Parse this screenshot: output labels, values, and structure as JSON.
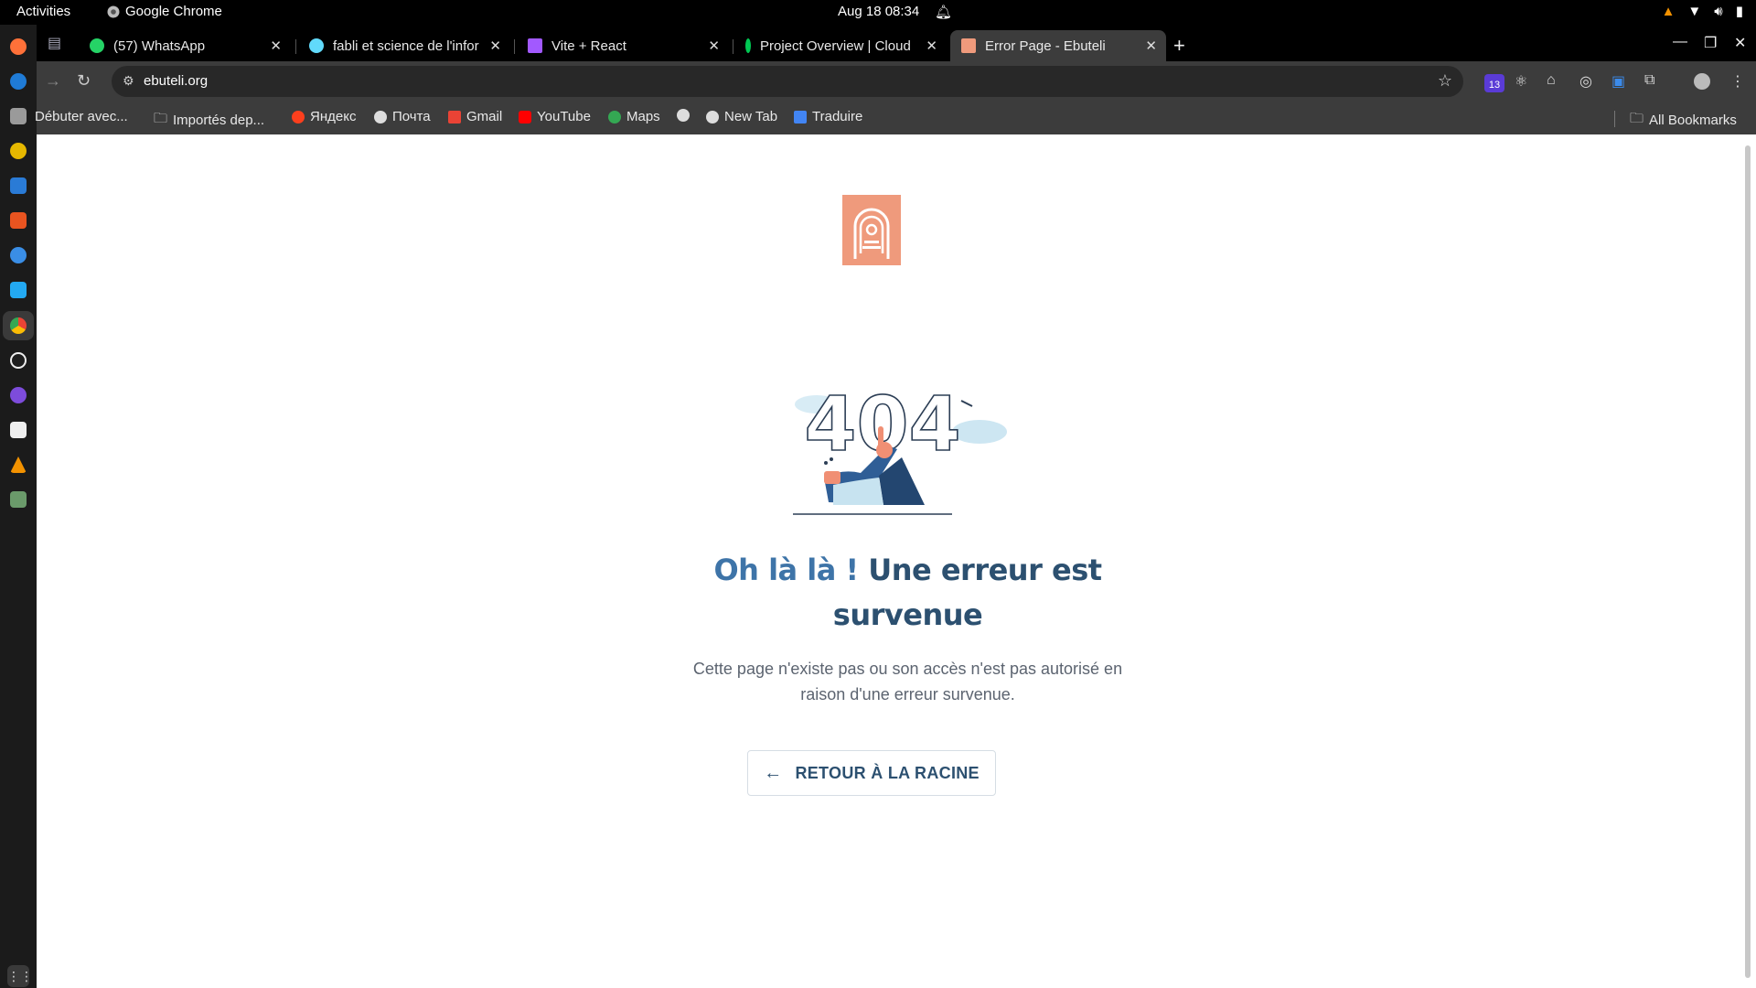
{
  "system": {
    "activities": "Activities",
    "app_name": "Google Chrome",
    "clock": "Aug 18  08:34"
  },
  "tabs": [
    {
      "label": "(57) WhatsApp",
      "favicon_color": "#25d366"
    },
    {
      "label": "fabli et science de l'infor",
      "favicon_color": "#61dafb"
    },
    {
      "label": "Vite + React",
      "favicon_color": "#a259ff"
    },
    {
      "label": "Project Overview | Cloud",
      "favicon_color": "#00c853"
    },
    {
      "label": "Error Page - Ebuteli",
      "favicon_color": "#ef9a7c",
      "active": true
    }
  ],
  "address_bar": {
    "url": "ebuteli.org"
  },
  "extensions": {
    "badge_count": "13"
  },
  "bookmarks": {
    "items": [
      "Débuter avec...",
      "Importés dep...",
      "Яндекс",
      "Почта",
      "Gmail",
      "YouTube",
      "Maps",
      "",
      "New Tab",
      "Traduire"
    ],
    "all_bookmarks": "All Bookmarks"
  },
  "page": {
    "illustration_text": "404",
    "headline_accent": "Oh là là !",
    "headline_rest": "Une erreur est survenue",
    "description": "Cette page n'existe pas ou son accès n'est pas autorisé en raison d'une erreur survenue.",
    "back_button": "RETOUR À LA RACINE"
  },
  "colors": {
    "brand_logo": "#ef9a7c",
    "headline": "#2c5070",
    "accent": "#3e74a8"
  }
}
